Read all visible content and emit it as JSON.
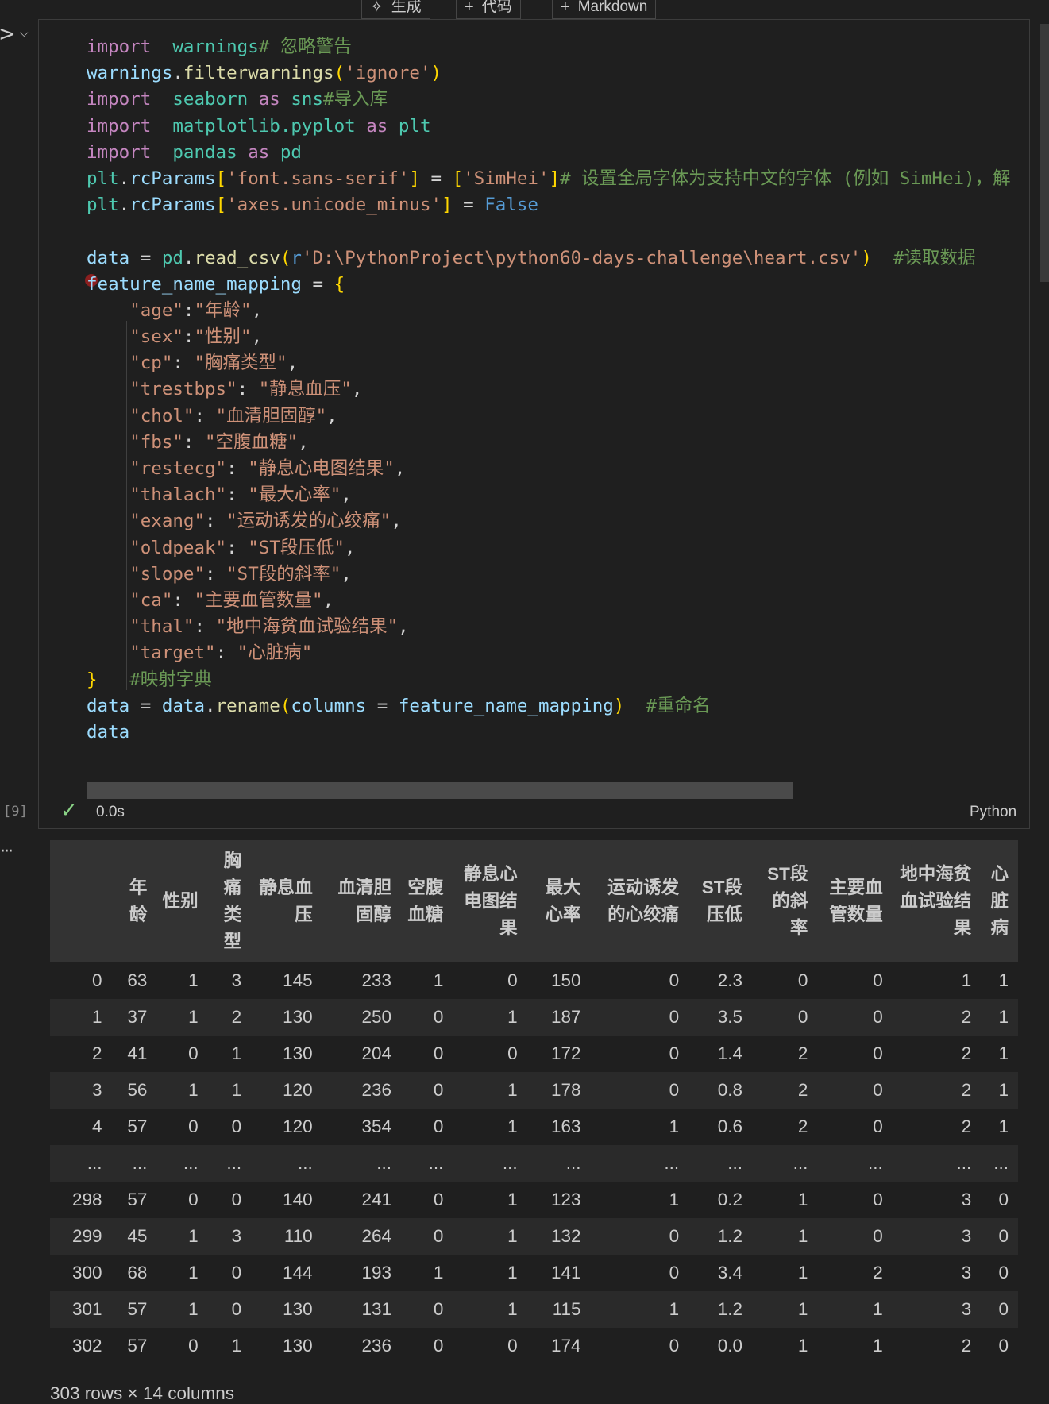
{
  "toolbar": {
    "generate_label": "生成",
    "code_label": "代码",
    "markdown_label": "Markdown"
  },
  "cell": {
    "execution_count": "[9]",
    "exec_time": "0.0s",
    "language": "Python"
  },
  "code_lines": [
    [
      [
        "kw",
        "import"
      ],
      [
        "",
        "  "
      ],
      [
        "mod",
        "warnings"
      ],
      [
        "cm",
        "# 忽略警告"
      ]
    ],
    [
      [
        "var",
        "warnings"
      ],
      [
        "op",
        "."
      ],
      [
        "fn",
        "filterwarnings"
      ],
      [
        "br1",
        "("
      ],
      [
        "str",
        "'ignore'"
      ],
      [
        "br1",
        ")"
      ]
    ],
    [
      [
        "kw",
        "import"
      ],
      [
        "",
        "  "
      ],
      [
        "mod",
        "seaborn"
      ],
      [
        "",
        ""
      ],
      [
        "kw",
        " as "
      ],
      [
        "mod",
        "sns"
      ],
      [
        "cm",
        "#导入库"
      ]
    ],
    [
      [
        "kw",
        "import"
      ],
      [
        "",
        "  "
      ],
      [
        "mod",
        "matplotlib.pyplot"
      ],
      [
        "kw",
        " as "
      ],
      [
        "mod",
        "plt"
      ]
    ],
    [
      [
        "kw",
        "import"
      ],
      [
        "",
        "  "
      ],
      [
        "mod",
        "pandas"
      ],
      [
        "kw",
        " as "
      ],
      [
        "mod",
        "pd"
      ]
    ],
    [
      [
        "mod",
        "plt"
      ],
      [
        "op",
        "."
      ],
      [
        "var",
        "rcParams"
      ],
      [
        "br1",
        "["
      ],
      [
        "str",
        "'font.sans-serif'"
      ],
      [
        "br1",
        "]"
      ],
      [
        "op",
        " = "
      ],
      [
        "br1",
        "["
      ],
      [
        "str",
        "'SimHei'"
      ],
      [
        "br1",
        "]"
      ],
      [
        "cm",
        "# 设置全局字体为支持中文的字体 (例如 SimHei)，解"
      ]
    ],
    [
      [
        "mod",
        "plt"
      ],
      [
        "op",
        "."
      ],
      [
        "var",
        "rcParams"
      ],
      [
        "br1",
        "["
      ],
      [
        "str",
        "'axes.unicode_minus'"
      ],
      [
        "br1",
        "]"
      ],
      [
        "op",
        " = "
      ],
      [
        "cst",
        "False"
      ]
    ],
    [
      [
        "",
        ""
      ]
    ],
    [
      [
        "var",
        "data"
      ],
      [
        "op",
        " = "
      ],
      [
        "mod",
        "pd"
      ],
      [
        "op",
        "."
      ],
      [
        "fn",
        "read_csv"
      ],
      [
        "br1",
        "("
      ],
      [
        "cst",
        "r"
      ],
      [
        "str",
        "'D:\\PythonProject\\python60-days-challenge\\heart.csv'"
      ],
      [
        "br1",
        ")"
      ],
      [
        "",
        "  "
      ],
      [
        "cm",
        "#读取数据"
      ]
    ],
    [
      [
        "var",
        "feature_name_mapping"
      ],
      [
        "op",
        " = "
      ],
      [
        "br1",
        "{"
      ]
    ],
    [
      [
        "",
        "    "
      ],
      [
        "str",
        "\"age\""
      ],
      [
        "op",
        ":"
      ],
      [
        "str",
        "\"年龄\""
      ],
      [
        "op",
        ","
      ]
    ],
    [
      [
        "",
        "    "
      ],
      [
        "str",
        "\"sex\""
      ],
      [
        "op",
        ":"
      ],
      [
        "str",
        "\"性别\""
      ],
      [
        "op",
        ","
      ]
    ],
    [
      [
        "",
        "    "
      ],
      [
        "str",
        "\"cp\""
      ],
      [
        "op",
        ": "
      ],
      [
        "str",
        "\"胸痛类型\""
      ],
      [
        "op",
        ","
      ]
    ],
    [
      [
        "",
        "    "
      ],
      [
        "str",
        "\"trestbps\""
      ],
      [
        "op",
        ": "
      ],
      [
        "str",
        "\"静息血压\""
      ],
      [
        "op",
        ","
      ]
    ],
    [
      [
        "",
        "    "
      ],
      [
        "str",
        "\"chol\""
      ],
      [
        "op",
        ": "
      ],
      [
        "str",
        "\"血清胆固醇\""
      ],
      [
        "op",
        ","
      ]
    ],
    [
      [
        "",
        "    "
      ],
      [
        "str",
        "\"fbs\""
      ],
      [
        "op",
        ": "
      ],
      [
        "str",
        "\"空腹血糖\""
      ],
      [
        "op",
        ","
      ]
    ],
    [
      [
        "",
        "    "
      ],
      [
        "str",
        "\"restecg\""
      ],
      [
        "op",
        ": "
      ],
      [
        "str",
        "\"静息心电图结果\""
      ],
      [
        "op",
        ","
      ]
    ],
    [
      [
        "",
        "    "
      ],
      [
        "str",
        "\"thalach\""
      ],
      [
        "op",
        ": "
      ],
      [
        "str",
        "\"最大心率\""
      ],
      [
        "op",
        ","
      ]
    ],
    [
      [
        "",
        "    "
      ],
      [
        "str",
        "\"exang\""
      ],
      [
        "op",
        ": "
      ],
      [
        "str",
        "\"运动诱发的心绞痛\""
      ],
      [
        "op",
        ","
      ]
    ],
    [
      [
        "",
        "    "
      ],
      [
        "str",
        "\"oldpeak\""
      ],
      [
        "op",
        ": "
      ],
      [
        "str",
        "\"ST段压低\""
      ],
      [
        "op",
        ","
      ]
    ],
    [
      [
        "",
        "    "
      ],
      [
        "str",
        "\"slope\""
      ],
      [
        "op",
        ": "
      ],
      [
        "str",
        "\"ST段的斜率\""
      ],
      [
        "op",
        ","
      ]
    ],
    [
      [
        "",
        "    "
      ],
      [
        "str",
        "\"ca\""
      ],
      [
        "op",
        ": "
      ],
      [
        "str",
        "\"主要血管数量\""
      ],
      [
        "op",
        ","
      ]
    ],
    [
      [
        "",
        "    "
      ],
      [
        "str",
        "\"thal\""
      ],
      [
        "op",
        ": "
      ],
      [
        "str",
        "\"地中海贫血试验结果\""
      ],
      [
        "op",
        ","
      ]
    ],
    [
      [
        "",
        "    "
      ],
      [
        "str",
        "\"target\""
      ],
      [
        "op",
        ": "
      ],
      [
        "str",
        "\"心脏病\""
      ]
    ],
    [
      [
        "br1",
        "}"
      ],
      [
        "",
        "   "
      ],
      [
        "cm",
        "#映射字典"
      ]
    ],
    [
      [
        "var",
        "data"
      ],
      [
        "op",
        " = "
      ],
      [
        "var",
        "data"
      ],
      [
        "op",
        "."
      ],
      [
        "fn",
        "rename"
      ],
      [
        "br1",
        "("
      ],
      [
        "var",
        "columns"
      ],
      [
        "op",
        " = "
      ],
      [
        "var",
        "feature_name_mapping"
      ],
      [
        "br1",
        ")"
      ],
      [
        "",
        "  "
      ],
      [
        "cm",
        "#重命名"
      ]
    ],
    [
      [
        "var",
        "data"
      ]
    ]
  ],
  "dataframe": {
    "columns": [
      "",
      "年龄",
      "性别",
      "胸痛类型",
      "静息血压",
      "血清胆固醇",
      "空腹血糖",
      "静息心电图结果",
      "最大心率",
      "运动诱发的心绞痛",
      "ST段压低",
      "ST段的斜率",
      "主要血管数量",
      "地中海贫血试验结果",
      "心脏病"
    ],
    "rows": [
      [
        "0",
        "63",
        "1",
        "3",
        "145",
        "233",
        "1",
        "0",
        "150",
        "0",
        "2.3",
        "0",
        "0",
        "1",
        "1"
      ],
      [
        "1",
        "37",
        "1",
        "2",
        "130",
        "250",
        "0",
        "1",
        "187",
        "0",
        "3.5",
        "0",
        "0",
        "2",
        "1"
      ],
      [
        "2",
        "41",
        "0",
        "1",
        "130",
        "204",
        "0",
        "0",
        "172",
        "0",
        "1.4",
        "2",
        "0",
        "2",
        "1"
      ],
      [
        "3",
        "56",
        "1",
        "1",
        "120",
        "236",
        "0",
        "1",
        "178",
        "0",
        "0.8",
        "2",
        "0",
        "2",
        "1"
      ],
      [
        "4",
        "57",
        "0",
        "0",
        "120",
        "354",
        "0",
        "1",
        "163",
        "1",
        "0.6",
        "2",
        "0",
        "2",
        "1"
      ],
      [
        "...",
        "...",
        "...",
        "...",
        "...",
        "...",
        "...",
        "...",
        "...",
        "...",
        "...",
        "...",
        "...",
        "...",
        "..."
      ],
      [
        "298",
        "57",
        "0",
        "0",
        "140",
        "241",
        "0",
        "1",
        "123",
        "1",
        "0.2",
        "1",
        "0",
        "3",
        "0"
      ],
      [
        "299",
        "45",
        "1",
        "3",
        "110",
        "264",
        "0",
        "1",
        "132",
        "0",
        "1.2",
        "1",
        "0",
        "3",
        "0"
      ],
      [
        "300",
        "68",
        "1",
        "0",
        "144",
        "193",
        "1",
        "1",
        "141",
        "0",
        "3.4",
        "1",
        "2",
        "3",
        "0"
      ],
      [
        "301",
        "57",
        "1",
        "0",
        "130",
        "131",
        "0",
        "1",
        "115",
        "1",
        "1.2",
        "1",
        "1",
        "3",
        "0"
      ],
      [
        "302",
        "57",
        "0",
        "1",
        "130",
        "236",
        "0",
        "0",
        "174",
        "0",
        "0.0",
        "1",
        "1",
        "2",
        "0"
      ]
    ],
    "summary": "303 rows × 14 columns"
  }
}
